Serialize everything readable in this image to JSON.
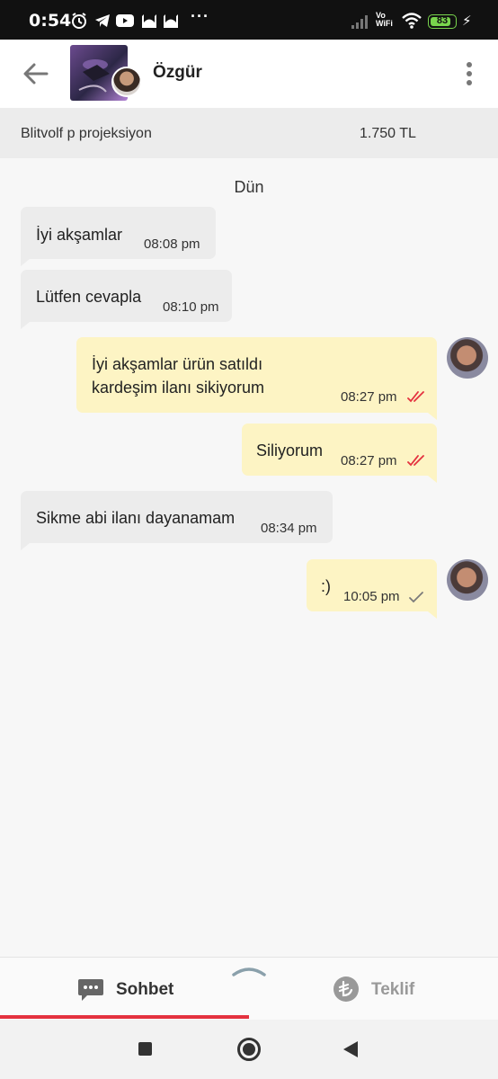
{
  "status_bar": {
    "time": "0:54",
    "dots": "···",
    "vowifi_top": "Vo",
    "vowifi_bottom": "WiFi",
    "battery_level": 83,
    "battery_text": "83"
  },
  "header": {
    "contact_name": "Özgür"
  },
  "listing": {
    "title": "Blitvolf p projeksiyon",
    "price": "1.750 TL"
  },
  "chat": {
    "day_separator": "Dün",
    "messages": [
      {
        "lines": [
          "İyi akşamlar"
        ],
        "time": "08:08 pm"
      },
      {
        "lines": [
          "Lütfen cevapla"
        ],
        "time": "08:10 pm"
      },
      {
        "lines": [
          "İyi akşamlar ürün satıldı",
          "kardeşim ilanı sikiyorum"
        ],
        "time": "08:27 pm"
      },
      {
        "lines": [
          "Siliyorum"
        ],
        "time": "08:27 pm"
      },
      {
        "lines": [
          "Sikme abi ilanı dayanamam"
        ],
        "time": "08:34 pm"
      },
      {
        "lines": [
          ":)"
        ],
        "time": "10:05 pm"
      }
    ]
  },
  "tabs": [
    {
      "label": "Sohbet",
      "selected": true
    },
    {
      "label": "Teklif",
      "selected": false
    }
  ],
  "colors": {
    "accent": "#e4323f",
    "incoming_bubble": "#ececec",
    "outgoing_bubble": "#fdf4c4",
    "read_check": "#e4323f",
    "sent_check": "#7a7a7a"
  },
  "icons": {
    "back": "arrow-left-icon",
    "more": "more-vert-icon",
    "chat_tab": "chat-bubble-icon",
    "offer_tab": "lira-coin-icon"
  }
}
